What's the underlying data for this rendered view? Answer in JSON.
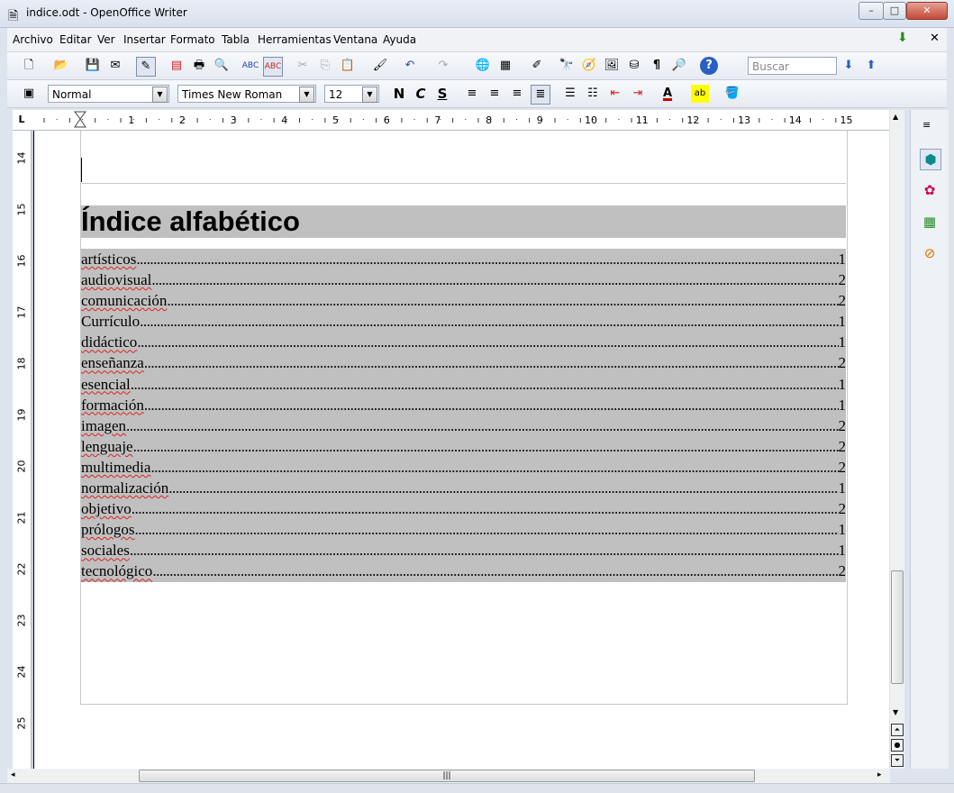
{
  "window": {
    "title": "indice.odt - OpenOffice Writer",
    "minimize": "–",
    "maximize": "□",
    "close": "✕"
  },
  "menu": [
    "Archivo",
    "Editar",
    "Ver",
    "Insertar",
    "Formato",
    "Tabla",
    "Herramientas",
    "Ventana",
    "Ayuda"
  ],
  "toolbar": {
    "search_placeholder": "Buscar"
  },
  "formatting": {
    "style": "Normal",
    "font": "Times New Roman",
    "size": "12",
    "bold": "N",
    "italic": "C",
    "underline": "S"
  },
  "ruler": {
    "corner": "L",
    "h_ticks": [
      "1",
      "2",
      "3",
      "4",
      "5",
      "6",
      "7",
      "8",
      "9",
      "10",
      "11",
      "12",
      "13",
      "14",
      "15"
    ],
    "v_ticks": [
      "14",
      "15",
      "16",
      "17",
      "18",
      "19",
      "20",
      "21",
      "22",
      "23",
      "24",
      "25"
    ]
  },
  "document": {
    "index_title": "Índice alfabético",
    "entries": [
      {
        "term": "artísticos",
        "page": "1",
        "spell": true
      },
      {
        "term": "audiovisual",
        "page": "2",
        "spell": true
      },
      {
        "term": "comunicación",
        "page": "2",
        "spell": true
      },
      {
        "term": "Currículo",
        "page": "1",
        "spell": false
      },
      {
        "term": "didáctico",
        "page": "1",
        "spell": true
      },
      {
        "term": "enseñanza",
        "page": "2",
        "spell": true
      },
      {
        "term": "esencial",
        "page": "1",
        "spell": true
      },
      {
        "term": "formación",
        "page": "1",
        "spell": true
      },
      {
        "term": "imagen",
        "page": "2",
        "spell": true
      },
      {
        "term": "lenguaje",
        "page": "2",
        "spell": true
      },
      {
        "term": "multimedia",
        "page": "2",
        "spell": true
      },
      {
        "term": "normalización",
        "page": "1",
        "spell": true
      },
      {
        "term": "objetivo",
        "page": "2",
        "spell": true
      },
      {
        "term": "prólogos",
        "page": "1",
        "spell": true
      },
      {
        "term": "sociales",
        "page": "1",
        "spell": true
      },
      {
        "term": "tecnológico",
        "page": "2",
        "spell": true
      }
    ]
  },
  "sidebar": [
    "properties-icon",
    "gallery-icon",
    "navigator-icon",
    "compass-icon"
  ]
}
